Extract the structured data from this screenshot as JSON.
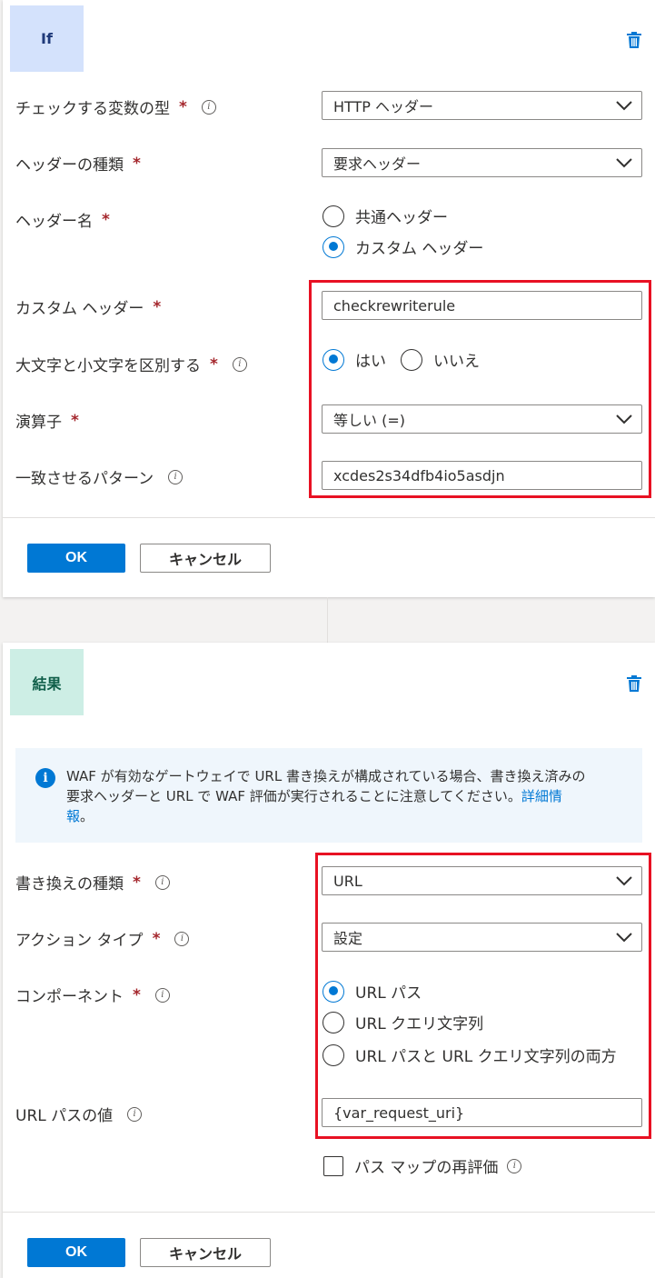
{
  "if_card": {
    "badge": "If",
    "variable_type": {
      "label": "チェックする変数の型",
      "required": "*",
      "value": "HTTP ヘッダー"
    },
    "header_kind": {
      "label": "ヘッダーの種類",
      "required": "*",
      "value": "要求ヘッダー"
    },
    "header_name": {
      "label": "ヘッダー名",
      "required": "*",
      "options": [
        "共通ヘッダー",
        "カスタム ヘッダー"
      ],
      "selected": "カスタム ヘッダー"
    },
    "custom_header": {
      "label": "カスタム ヘッダー",
      "required": "*",
      "value": "checkrewriterule"
    },
    "case_sensitive": {
      "label": "大文字と小文字を区別する",
      "required": "*",
      "options": [
        "はい",
        "いいえ"
      ],
      "selected": "はい"
    },
    "operator": {
      "label": "演算子",
      "required": "*",
      "value": "等しい (=)"
    },
    "pattern": {
      "label": "一致させるパターン",
      "value": "xcdes2s34dfb4io5asdjn"
    },
    "ok": "OK",
    "cancel": "キャンセル"
  },
  "result_card": {
    "badge": "結果",
    "info_line1": "WAF が有効なゲートウェイで URL 書き換えが構成されている場合、書き換え済みの",
    "info_line2": "要求ヘッダーと URL で WAF 評価が実行されることに注意してください。",
    "info_link_a": "詳細情",
    "info_link_b": "報",
    "info_tail": "。",
    "rewrite_type": {
      "label": "書き換えの種類",
      "required": "*",
      "value": "URL"
    },
    "action_type": {
      "label": "アクション タイプ",
      "required": "*",
      "value": "設定"
    },
    "component": {
      "label": "コンポーネント",
      "required": "*",
      "options": [
        "URL パス",
        "URL クエリ文字列",
        "URL パスと URL クエリ文字列の両方"
      ],
      "selected": "URL パス"
    },
    "url_path_value": {
      "label": "URL パスの値",
      "value": "{var_request_uri}"
    },
    "reevaluate": {
      "label": "パス マップの再評価",
      "checked": false
    },
    "ok": "OK",
    "cancel": "キャンセル"
  },
  "colors": {
    "accent": "#0078d4",
    "highlight": "#e81123",
    "required": "#a4262c"
  }
}
